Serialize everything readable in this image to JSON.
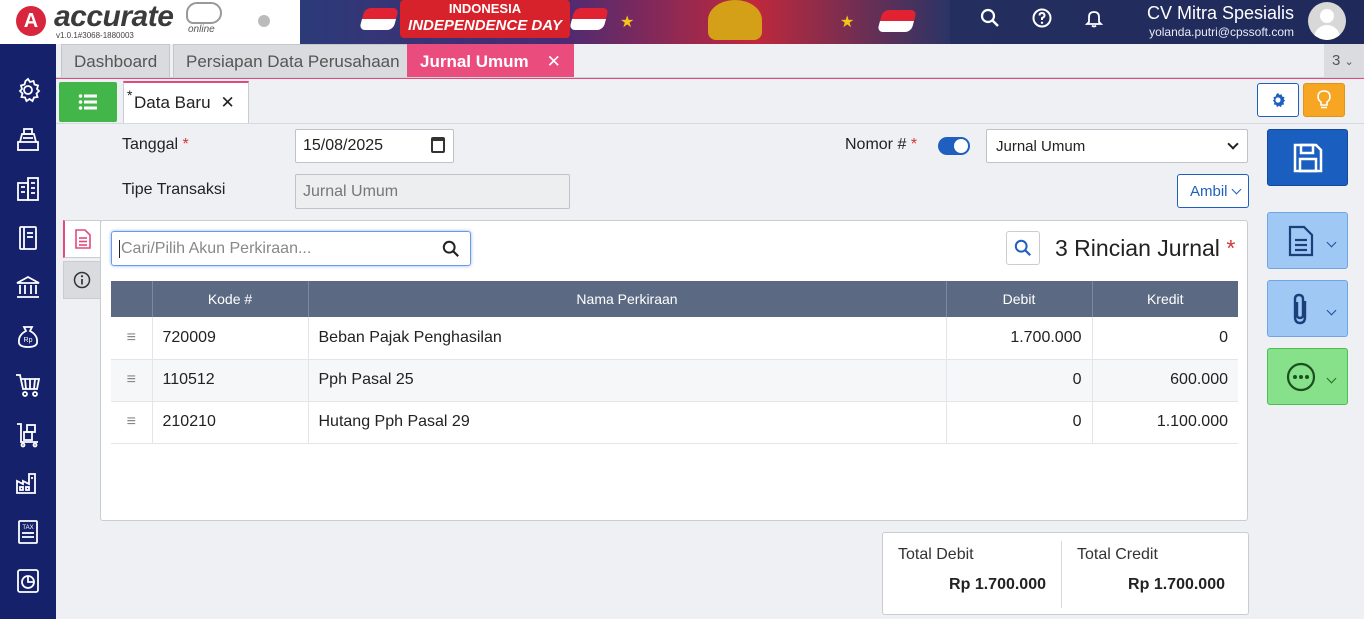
{
  "app": {
    "logo_text": "accurate",
    "logo_sub": "online",
    "version": "v1.0.1#3068-1880003",
    "banner_line1": "INDONESIA",
    "banner_line2": "INDEPENDENCE DAY"
  },
  "header": {
    "company_name": "CV Mitra Spesialis",
    "user_email": "yolanda.putri@cpssoft.com",
    "icons": [
      "search-icon",
      "help-icon",
      "bell-icon",
      "user-avatar"
    ]
  },
  "sidebar": {
    "items": [
      "settings-icon",
      "cash-register-icon",
      "buildings-icon",
      "book-icon",
      "bank-icon",
      "money-bag-icon",
      "cart-icon",
      "inventory-icon",
      "factory-icon",
      "tax-icon",
      "report-icon"
    ]
  },
  "tabs": [
    {
      "label": "Dashboard",
      "active": false
    },
    {
      "label": "Persiapan Data Perusahaan",
      "active": false
    },
    {
      "label": "Jurnal Umum",
      "active": true
    }
  ],
  "tab_count": "3",
  "subtab": {
    "marker": "*",
    "label": "Data Baru"
  },
  "form": {
    "tanggal_label": "Tanggal",
    "tanggal_value": "15/08/2025",
    "tipe_label": "Tipe Transaksi",
    "tipe_value": "Jurnal Umum",
    "nomor_label": "Nomor #",
    "nomor_select": "Jurnal Umum",
    "ambil_label": "Ambil",
    "required_mark": "*"
  },
  "grid": {
    "search_placeholder": "Cari/Pilih Akun Perkiraan...",
    "title": "3 Rincian Jurnal",
    "columns": [
      "Kode #",
      "Nama Perkiraan",
      "Debit",
      "Kredit"
    ],
    "rows": [
      {
        "kode": "720009",
        "nama": "Beban Pajak Penghasilan",
        "debit": "1.700.000",
        "kredit": "0"
      },
      {
        "kode": "110512",
        "nama": "Pph Pasal 25",
        "debit": "0",
        "kredit": "600.000"
      },
      {
        "kode": "210210",
        "nama": "Hutang Pph Pasal 29",
        "debit": "0",
        "kredit": "1.100.000"
      }
    ]
  },
  "totals": {
    "debit_label": "Total Debit",
    "debit_value": "Rp 1.700.000",
    "credit_label": "Total Credit",
    "credit_value": "Rp 1.700.000"
  },
  "colors": {
    "sidebar": "#15226b",
    "accent_pink": "#ea4c7d",
    "primary_blue": "#1a5fc0",
    "green": "#43b649"
  }
}
